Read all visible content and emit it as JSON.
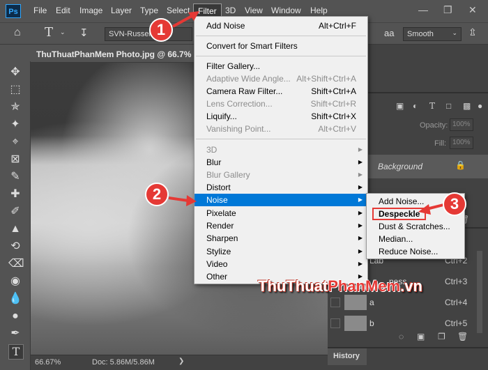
{
  "app": {
    "logo": "Ps"
  },
  "menubar": {
    "items": [
      "File",
      "Edit",
      "Image",
      "Layer",
      "Type",
      "Select",
      "Filter",
      "3D",
      "View",
      "Window",
      "Help"
    ],
    "active": "Filter"
  },
  "options": {
    "font_family": "SVN-Russell",
    "aa_icon": "aa",
    "antialias": "Smooth"
  },
  "document": {
    "tab_title": "ThuThuatPhanMem Photo.jpg @ 66.7% (Lig",
    "zoom": "66.67%",
    "doc_info": "Doc: 5.86M/5.86M"
  },
  "layers_panel": {
    "opacity_label": "Opacity:",
    "opacity_value": "100%",
    "fill_label": "Fill:",
    "fill_value": "100%",
    "background_label": "Background"
  },
  "channels_panel": {
    "rows": [
      {
        "name": "Lab",
        "shortcut": "Ctrl+2"
      },
      {
        "name": "ness",
        "shortcut": "Ctrl+3"
      },
      {
        "name": "a",
        "shortcut": "Ctrl+4"
      },
      {
        "name": "b",
        "shortcut": "Ctrl+5"
      }
    ]
  },
  "history_panel": {
    "title": "History"
  },
  "filter_menu": {
    "items": [
      {
        "label": "Add Noise",
        "shortcut": "Alt+Ctrl+F",
        "disabled": false
      },
      {
        "label": "Convert for Smart Filters",
        "shortcut": "",
        "disabled": false
      },
      {
        "label": "Filter Gallery...",
        "shortcut": "",
        "disabled": false
      },
      {
        "label": "Adaptive Wide Angle...",
        "shortcut": "Alt+Shift+Ctrl+A",
        "disabled": true
      },
      {
        "label": "Camera Raw Filter...",
        "shortcut": "Shift+Ctrl+A",
        "disabled": false
      },
      {
        "label": "Lens Correction...",
        "shortcut": "Shift+Ctrl+R",
        "disabled": true
      },
      {
        "label": "Liquify...",
        "shortcut": "Shift+Ctrl+X",
        "disabled": false
      },
      {
        "label": "Vanishing Point...",
        "shortcut": "Alt+Ctrl+V",
        "disabled": true
      },
      {
        "label": "3D",
        "submenu": true,
        "disabled": true
      },
      {
        "label": "Blur",
        "submenu": true,
        "disabled": false
      },
      {
        "label": "Blur Gallery",
        "submenu": true,
        "disabled": true
      },
      {
        "label": "Distort",
        "submenu": true,
        "disabled": false
      },
      {
        "label": "Noise",
        "submenu": true,
        "disabled": false,
        "highlighted": true
      },
      {
        "label": "Pixelate",
        "submenu": true,
        "disabled": false
      },
      {
        "label": "Render",
        "submenu": true,
        "disabled": false
      },
      {
        "label": "Sharpen",
        "submenu": true,
        "disabled": false
      },
      {
        "label": "Stylize",
        "submenu": true,
        "disabled": false
      },
      {
        "label": "Video",
        "submenu": true,
        "disabled": false
      },
      {
        "label": "Other",
        "submenu": true,
        "disabled": false
      }
    ]
  },
  "noise_submenu": {
    "items": [
      "Add Noise...",
      "Despeckle",
      "Dust & Scratches...",
      "Median...",
      "Reduce Noise..."
    ],
    "boxed": "Despeckle"
  },
  "callouts": {
    "one": "1",
    "two": "2",
    "three": "3",
    "accent": "#e53935"
  },
  "watermark": {
    "part1": "ThuThuat",
    "part2": "PhanMem",
    "part3": ".vn"
  }
}
